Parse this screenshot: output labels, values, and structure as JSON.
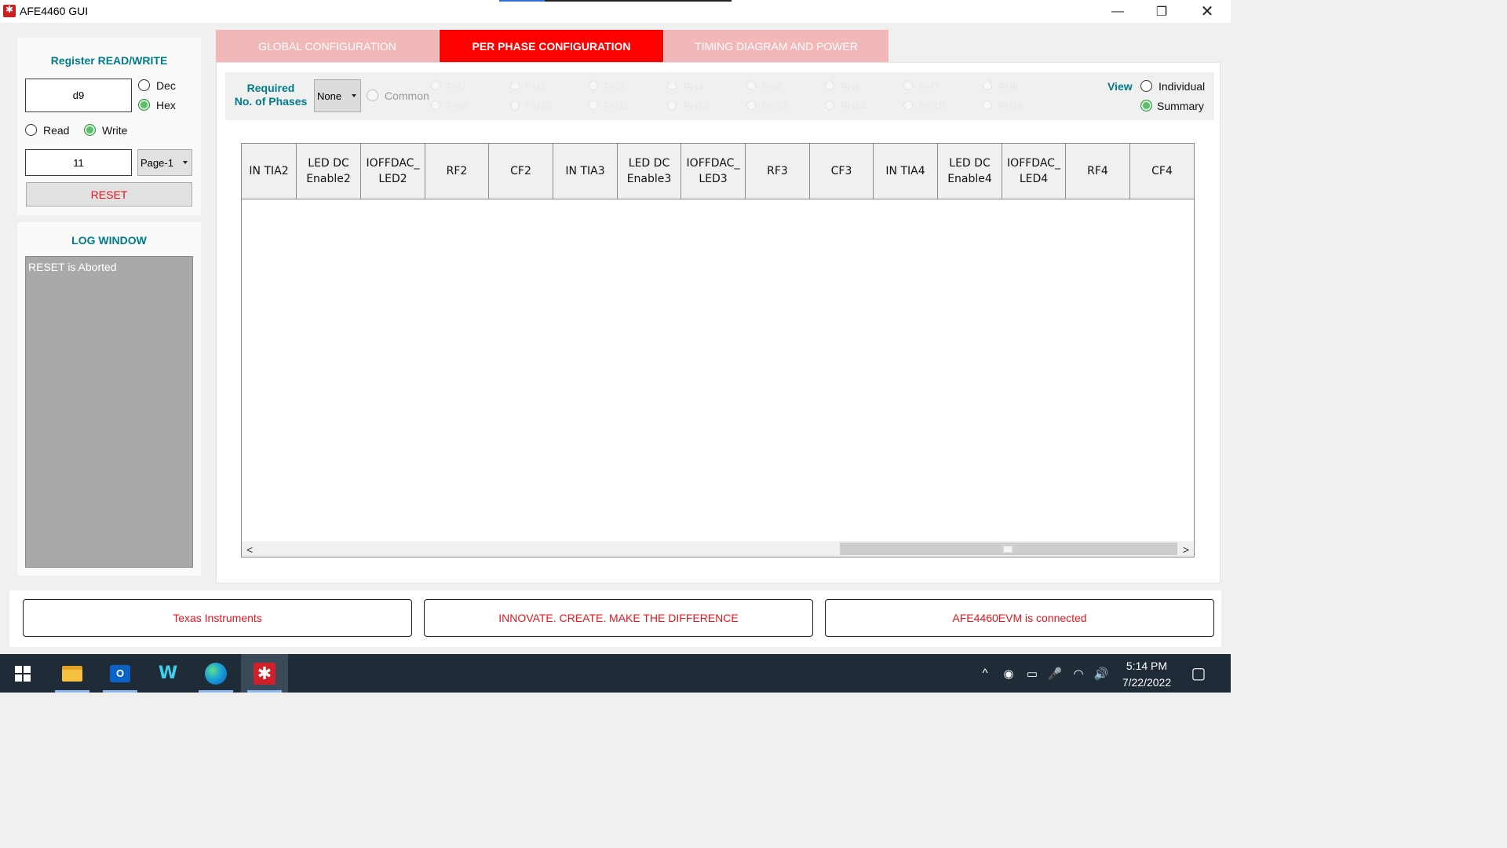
{
  "window": {
    "title": "AFE4460 GUI",
    "minimize_glyph": "—",
    "maximize_glyph": "❐",
    "close_glyph": "✕"
  },
  "register_panel": {
    "title": "Register READ/WRITE",
    "address_value": "d9",
    "format_options": [
      {
        "label": "Dec",
        "selected": false
      },
      {
        "label": "Hex",
        "selected": true
      }
    ],
    "mode_options": [
      {
        "label": "Read",
        "selected": false
      },
      {
        "label": "Write",
        "selected": true
      }
    ],
    "data_value": "11",
    "page_select": "Page-1",
    "reset_label": "RESET"
  },
  "log_panel": {
    "title": "LOG WINDOW",
    "text": "RESET is Aborted"
  },
  "tabs": [
    {
      "label": "GLOBAL CONFIGURATION",
      "active": false
    },
    {
      "label": "PER PHASE CONFIGURATION",
      "active": true
    },
    {
      "label": "TIMING DIAGRAM AND POWER",
      "active": false
    }
  ],
  "phase_bar": {
    "required_label_line1": "Required",
    "required_label_line2": "No. of Phases",
    "phases_select": "None",
    "common_label": "Common",
    "phases_row1": [
      "PH1",
      "PH2",
      "PH3",
      "PH4",
      "PH5",
      "PH6",
      "PH7",
      "PH8"
    ],
    "phases_row2": [
      "PH9",
      "PH10",
      "PH11",
      "PH12",
      "PH13",
      "PH14",
      "PH15",
      "PH16"
    ],
    "view_label": "View",
    "view_options": [
      {
        "label": "Individual",
        "selected": false
      },
      {
        "label": "Summary",
        "selected": true
      }
    ]
  },
  "grid": {
    "columns": [
      "IN TIA2",
      "LED DC Enable2",
      "IOFFDAC_ LED2",
      "RF2",
      "CF2",
      "IN TIA3",
      "LED DC Enable3",
      "IOFFDAC_ LED3",
      "RF3",
      "CF3",
      "IN TIA4",
      "LED DC Enable4",
      "IOFFDAC_ LED4",
      "RF4",
      "CF4"
    ],
    "rows": [],
    "scroll_left_glyph": "<",
    "scroll_right_glyph": ">"
  },
  "footer": {
    "left": "Texas Instruments",
    "center": "INNOVATE. CREATE. MAKE THE DIFFERENCE",
    "right": "AFE4460EVM is connected"
  },
  "taskbar": {
    "apps": [
      "windows-start",
      "file-explorer",
      "outlook",
      "webex",
      "edge",
      "afe4460-gui"
    ],
    "outlook_glyph": "O",
    "webex_glyph": "W",
    "ti_glyph": "✱",
    "tray_icons": [
      "^",
      "◉",
      "▭",
      "🎤",
      "◠",
      "🔊"
    ],
    "time": "5:14 PM",
    "date": "7/22/2022",
    "notification_glyph": "▢"
  },
  "colors": {
    "accent_teal": "#007b8a",
    "active_tab": "#ff0000",
    "inactive_tab": "#f2b8b9",
    "alert_red": "#e8141d",
    "radio_selected": "#5cbe6b",
    "taskbar": "#1f2b36"
  }
}
